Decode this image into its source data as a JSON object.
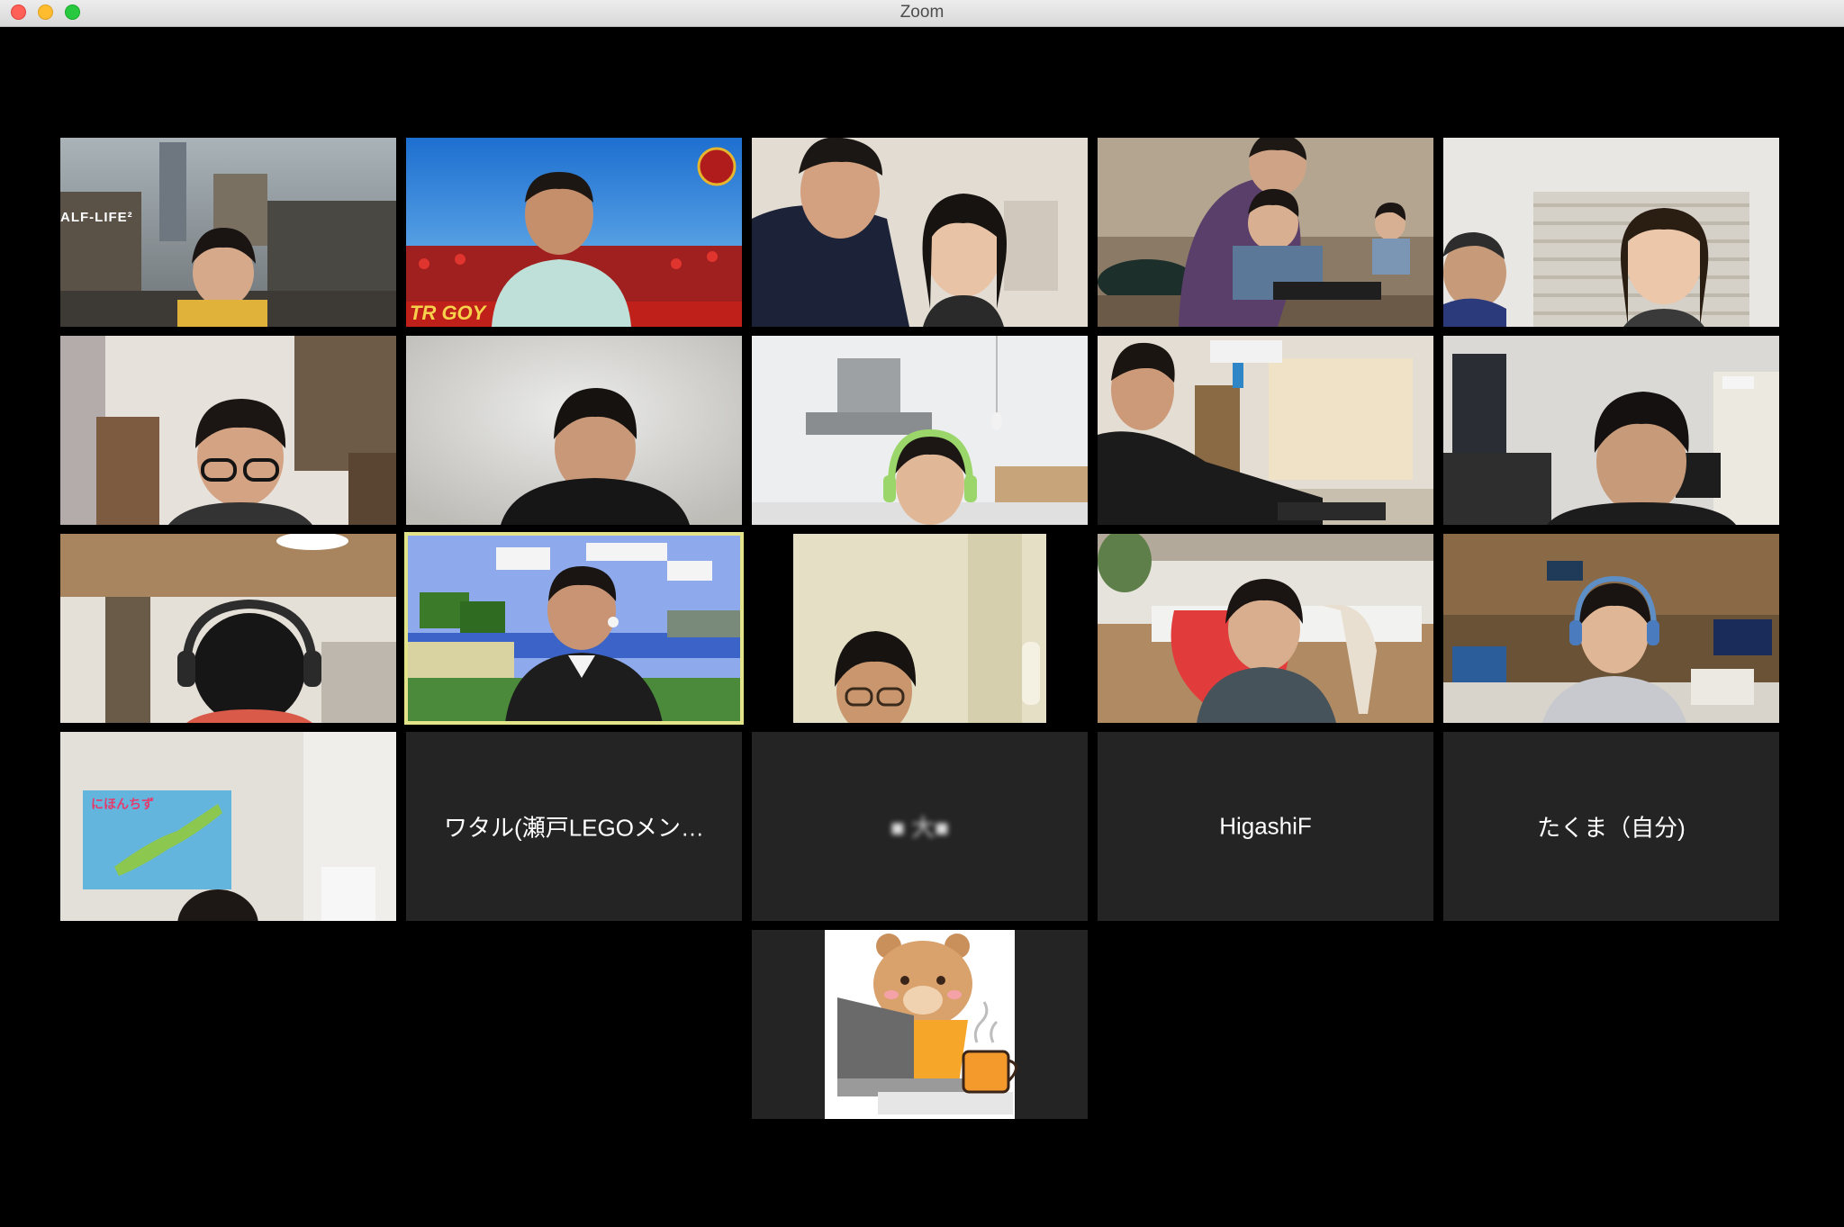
{
  "window": {
    "title": "Zoom"
  },
  "grid": {
    "rows": [
      [
        {
          "id": "p1",
          "type": "video",
          "scene": "halflife"
        },
        {
          "id": "p2",
          "type": "video",
          "scene": "stadium"
        },
        {
          "id": "p3",
          "type": "video",
          "scene": "family"
        },
        {
          "id": "p4",
          "type": "video",
          "scene": "desk-kids"
        },
        {
          "id": "p5",
          "type": "video",
          "scene": "window-room"
        }
      ],
      [
        {
          "id": "p6",
          "type": "video",
          "scene": "glasses-boy"
        },
        {
          "id": "p7",
          "type": "video",
          "scene": "white-wall"
        },
        {
          "id": "p8",
          "type": "video",
          "scene": "kitchen-headset"
        },
        {
          "id": "p9",
          "type": "video",
          "scene": "typing-man"
        },
        {
          "id": "p10",
          "type": "video",
          "scene": "monitors-room"
        }
      ],
      [
        {
          "id": "p11",
          "type": "video",
          "scene": "headphones-down"
        },
        {
          "id": "p12",
          "type": "video",
          "scene": "minecraft",
          "active": true
        },
        {
          "id": "p13",
          "type": "video",
          "scene": "pillarbox-glasses"
        },
        {
          "id": "p14",
          "type": "video",
          "scene": "red-chair"
        },
        {
          "id": "p15",
          "type": "video",
          "scene": "studio-headset"
        }
      ],
      [
        {
          "id": "p16",
          "type": "video",
          "scene": "map-poster"
        },
        {
          "id": "p17",
          "type": "name",
          "name": "ワタル(瀬戸LEGOメン…"
        },
        {
          "id": "p18",
          "type": "name",
          "name": "■ 大■",
          "blurred": true
        },
        {
          "id": "p19",
          "type": "name",
          "name": "HigashiF"
        },
        {
          "id": "p20",
          "type": "name",
          "name": "たくま（自分)"
        }
      ],
      [
        {
          "id": "p21",
          "type": "avatar",
          "avatar": "bear-laptop-coffee"
        }
      ]
    ]
  },
  "tile_text": {
    "halflife_logo": "ALF-LIFE²",
    "stadium_banner": "TR    GOY",
    "map_poster_title": "にほんちず"
  },
  "colors": {
    "titlebar": "#e3e3e3",
    "tile_bg": "#242424",
    "active_speaker": "#e3e38a",
    "background": "#000000"
  }
}
